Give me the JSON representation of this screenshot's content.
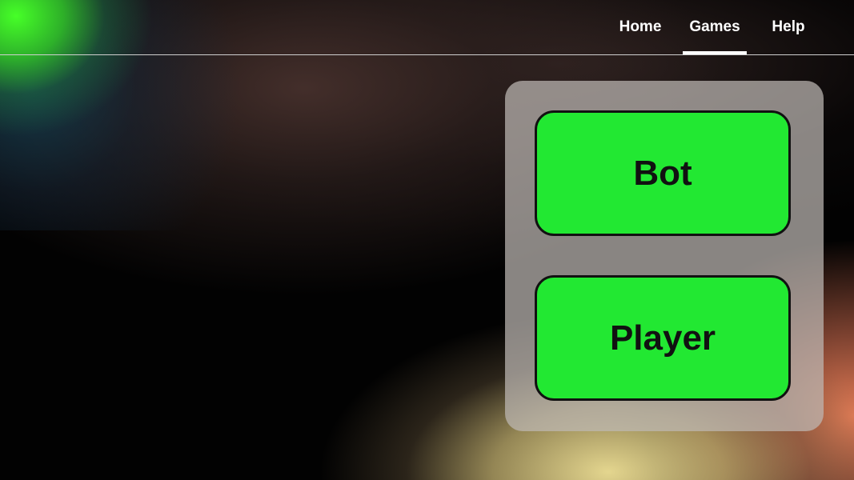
{
  "nav": {
    "items": [
      {
        "label": "Home"
      },
      {
        "label": "Games",
        "active": true
      },
      {
        "label": "Help"
      }
    ]
  },
  "game_mode_panel": {
    "buttons": [
      {
        "label": "Bot"
      },
      {
        "label": "Player"
      }
    ]
  },
  "colors": {
    "button_fill": "#22e832",
    "button_border": "#111111",
    "nav_text": "#ffffff",
    "panel_fill": "#beb9b4",
    "background": "#020202"
  }
}
